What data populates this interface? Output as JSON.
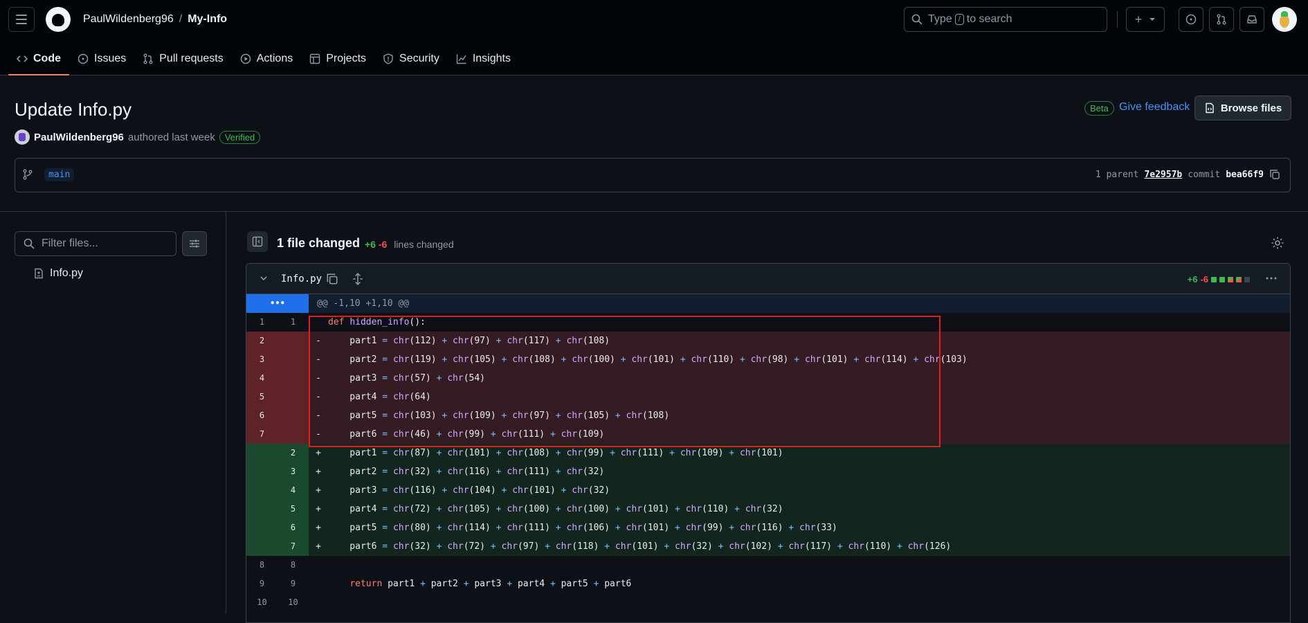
{
  "header": {
    "owner": "PaulWildenberg96",
    "separator": "/",
    "repo": "My-Info",
    "search_prefix": "Type",
    "search_key": "/",
    "search_suffix": "to search",
    "plus_label": "+"
  },
  "tabs": [
    {
      "label": "Code",
      "icon": "code-icon",
      "active": true
    },
    {
      "label": "Issues",
      "icon": "issue-icon"
    },
    {
      "label": "Pull requests",
      "icon": "pull-request-icon"
    },
    {
      "label": "Actions",
      "icon": "play-icon"
    },
    {
      "label": "Projects",
      "icon": "table-icon"
    },
    {
      "label": "Security",
      "icon": "shield-icon"
    },
    {
      "label": "Insights",
      "icon": "graph-icon"
    }
  ],
  "commit": {
    "title": "Update Info.py",
    "author": "PaulWildenberg96",
    "authored_text": "authored last week",
    "verified": "Verified",
    "beta": "Beta",
    "feedback": "Give feedback",
    "browse_files": "Browse files",
    "branch": "main",
    "parent_label": "1 parent",
    "parent_hash": "7e2957b",
    "commit_label": "commit",
    "commit_hash": "bea66f9"
  },
  "sidebar": {
    "filter_placeholder": "Filter files...",
    "files": [
      "Info.py"
    ]
  },
  "summary": {
    "files_changed": "1 file changed",
    "additions": "+6",
    "deletions": "-6",
    "lines_changed": "lines changed"
  },
  "file": {
    "name": "Info.py",
    "additions": "+6",
    "deletions": "-6",
    "hunk_header": "@@ -1,10 +1,10 @@",
    "colors": {
      "add": "#3fb950",
      "del": "#f85149",
      "highlight": "#e11d1d"
    }
  },
  "diff": [
    {
      "type": "ctx",
      "old": "1",
      "new": "1",
      "sign": "",
      "text": "def hidden_info():"
    },
    {
      "type": "del",
      "old": "2",
      "new": "",
      "sign": "-",
      "text": "    part1 = chr(112) + chr(97) + chr(117) + chr(108)"
    },
    {
      "type": "del",
      "old": "3",
      "new": "",
      "sign": "-",
      "text": "    part2 = chr(119) + chr(105) + chr(108) + chr(100) + chr(101) + chr(110) + chr(98) + chr(101) + chr(114) + chr(103)"
    },
    {
      "type": "del",
      "old": "4",
      "new": "",
      "sign": "-",
      "text": "    part3 = chr(57) + chr(54)"
    },
    {
      "type": "del",
      "old": "5",
      "new": "",
      "sign": "-",
      "text": "    part4 = chr(64)"
    },
    {
      "type": "del",
      "old": "6",
      "new": "",
      "sign": "-",
      "text": "    part5 = chr(103) + chr(109) + chr(97) + chr(105) + chr(108)"
    },
    {
      "type": "del",
      "old": "7",
      "new": "",
      "sign": "-",
      "text": "    part6 = chr(46) + chr(99) + chr(111) + chr(109)"
    },
    {
      "type": "add",
      "old": "",
      "new": "2",
      "sign": "+",
      "text": "    part1 = chr(87) + chr(101) + chr(108) + chr(99) + chr(111) + chr(109) + chr(101)"
    },
    {
      "type": "add",
      "old": "",
      "new": "3",
      "sign": "+",
      "text": "    part2 = chr(32) + chr(116) + chr(111) + chr(32)"
    },
    {
      "type": "add",
      "old": "",
      "new": "4",
      "sign": "+",
      "text": "    part3 = chr(116) + chr(104) + chr(101) + chr(32)"
    },
    {
      "type": "add",
      "old": "",
      "new": "5",
      "sign": "+",
      "text": "    part4 = chr(72) + chr(105) + chr(100) + chr(100) + chr(101) + chr(110) + chr(32)"
    },
    {
      "type": "add",
      "old": "",
      "new": "6",
      "sign": "+",
      "text": "    part5 = chr(80) + chr(114) + chr(111) + chr(106) + chr(101) + chr(99) + chr(116) + chr(33)"
    },
    {
      "type": "add",
      "old": "",
      "new": "7",
      "sign": "+",
      "text": "    part6 = chr(32) + chr(72) + chr(97) + chr(118) + chr(101) + chr(32) + chr(102) + chr(117) + chr(110) + chr(126)"
    },
    {
      "type": "ctx",
      "old": "8",
      "new": "8",
      "sign": "",
      "text": ""
    },
    {
      "type": "ctx",
      "old": "9",
      "new": "9",
      "sign": "",
      "text": "    return part1 + part2 + part3 + part4 + part5 + part6"
    },
    {
      "type": "ctx",
      "old": "10",
      "new": "10",
      "sign": "",
      "text": ""
    }
  ]
}
